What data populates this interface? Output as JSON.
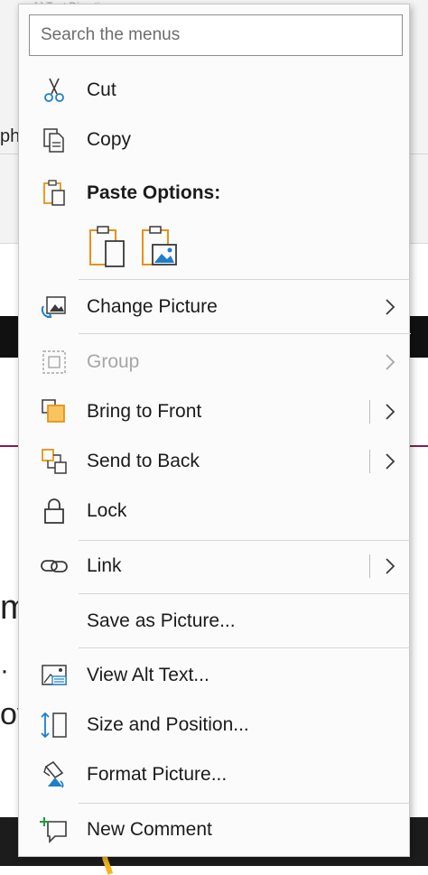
{
  "background": {
    "partial_text_top": "[ ] Text Direction ~",
    "partial_text_left": "ph",
    "partial_text_m": "m",
    "partial_text_dot": "·",
    "partial_text_ov": "ov"
  },
  "search": {
    "placeholder": "Search the menus"
  },
  "menu": {
    "cut": "Cut",
    "copy": "Copy",
    "paste_options": "Paste Options:",
    "change_picture": "Change Picture",
    "group": "Group",
    "bring_to_front": "Bring to Front",
    "send_to_back": "Send to Back",
    "lock": "Lock",
    "link": "Link",
    "save_as_picture": "Save as Picture...",
    "view_alt_text": "View Alt Text...",
    "size_and_position": "Size and Position...",
    "format_picture": "Format Picture...",
    "new_comment": "New Comment"
  },
  "icons": {
    "cut": "scissors-icon",
    "copy": "copy-icon",
    "paste": "clipboard-icon",
    "change_picture": "change-picture-icon",
    "group": "group-icon",
    "bring_to_front": "bring-to-front-icon",
    "send_to_back": "send-to-back-icon",
    "lock": "lock-icon",
    "link": "link-icon",
    "view_alt_text": "alt-text-icon",
    "size_and_position": "size-position-icon",
    "format_picture": "format-picture-icon",
    "new_comment": "new-comment-icon"
  },
  "colors": {
    "accent_orange": "#e8911a",
    "accent_blue": "#1e7ecb",
    "disabled": "#a6a6a6"
  }
}
